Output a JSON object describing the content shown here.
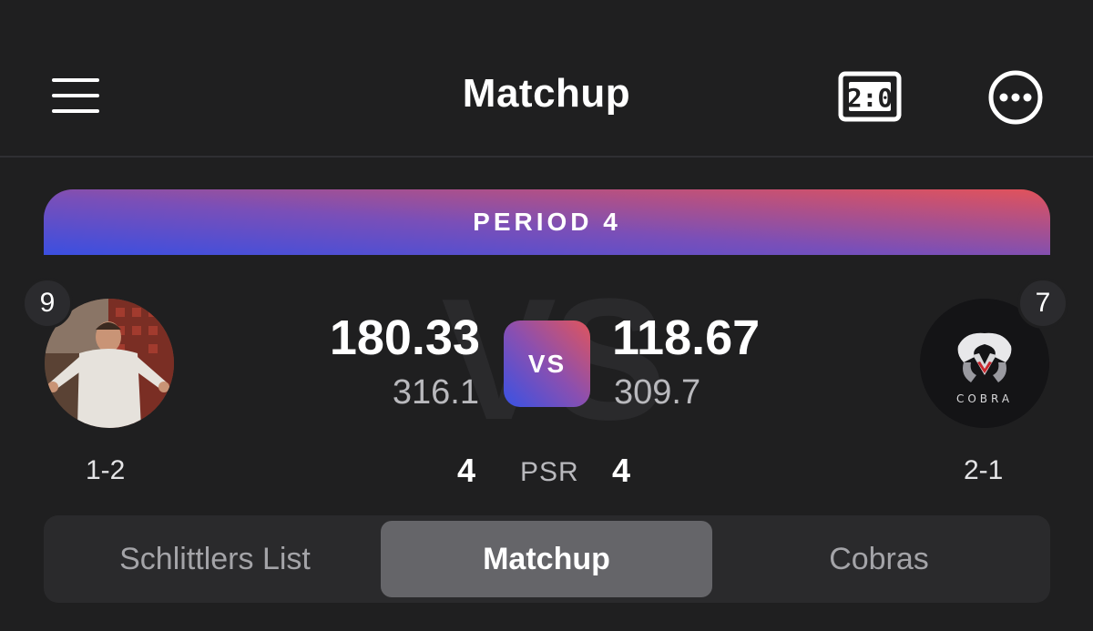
{
  "header": {
    "title": "Matchup",
    "menu_icon": "hamburger-menu-icon",
    "scoreboard_icon": "scoreboard-icon",
    "scoreboard_icon_text": "2:0",
    "more_icon": "more-options-icon"
  },
  "period": {
    "label": "PERIOD 4"
  },
  "matchup": {
    "vs_label": "VS",
    "psr_label": "PSR",
    "left_team": {
      "seed": "9",
      "score": "180.33",
      "projected": "316.1",
      "psr": "4",
      "record": "1-2"
    },
    "right_team": {
      "seed": "7",
      "score": "118.67",
      "projected": "309.7",
      "psr": "4",
      "record": "2-1",
      "logo_text": "COBRA"
    }
  },
  "tabs": [
    {
      "label": "Schlittlers List",
      "active": false
    },
    {
      "label": "Matchup",
      "active": true
    },
    {
      "label": "Cobras",
      "active": false
    }
  ],
  "colors": {
    "background": "#1f1f20",
    "gradient_start": "#3b4fe0",
    "gradient_end": "#e2525a",
    "active_tab": "#656569"
  }
}
